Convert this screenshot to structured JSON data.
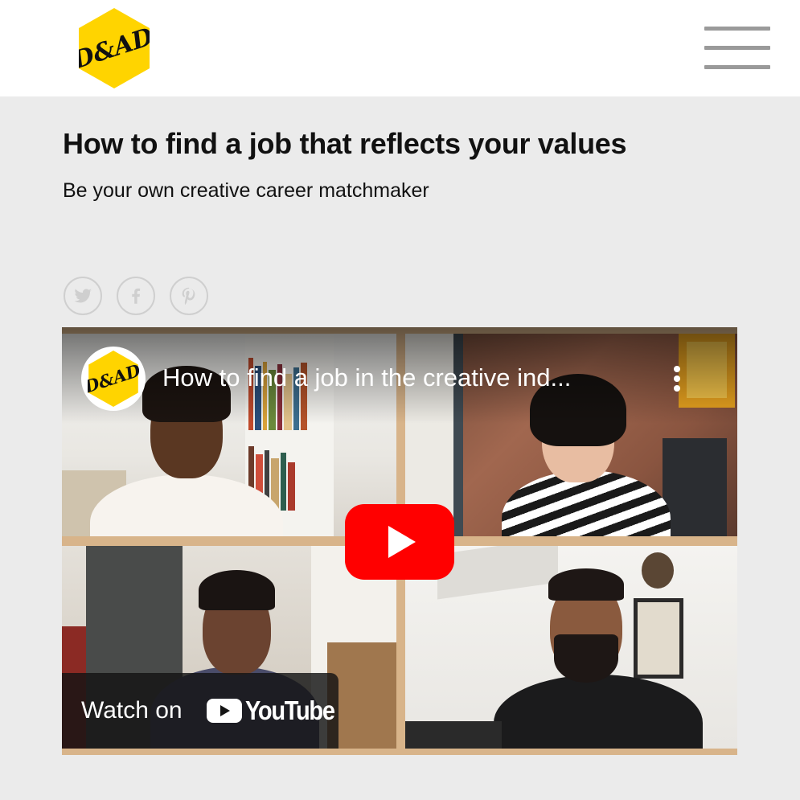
{
  "header": {
    "logo_text": "D&AD",
    "menu_icon": "hamburger-menu-icon"
  },
  "article": {
    "title": "How to find a job that reflects your values",
    "subtitle": "Be your own creative career matchmaker"
  },
  "share": {
    "icons": [
      "twitter-icon",
      "facebook-icon",
      "pinterest-icon"
    ]
  },
  "video": {
    "title": "How to find a job in the creative ind...",
    "channel_logo_text": "D&AD",
    "watch_on_label": "Watch on",
    "youtube_label": "YouTube",
    "colors": {
      "play_button": "#ff0000",
      "frame": "#d8b48a"
    }
  },
  "colors": {
    "brand_yellow": "#ffd400",
    "page_bg": "#ebebeb",
    "header_bg": "#ffffff"
  }
}
